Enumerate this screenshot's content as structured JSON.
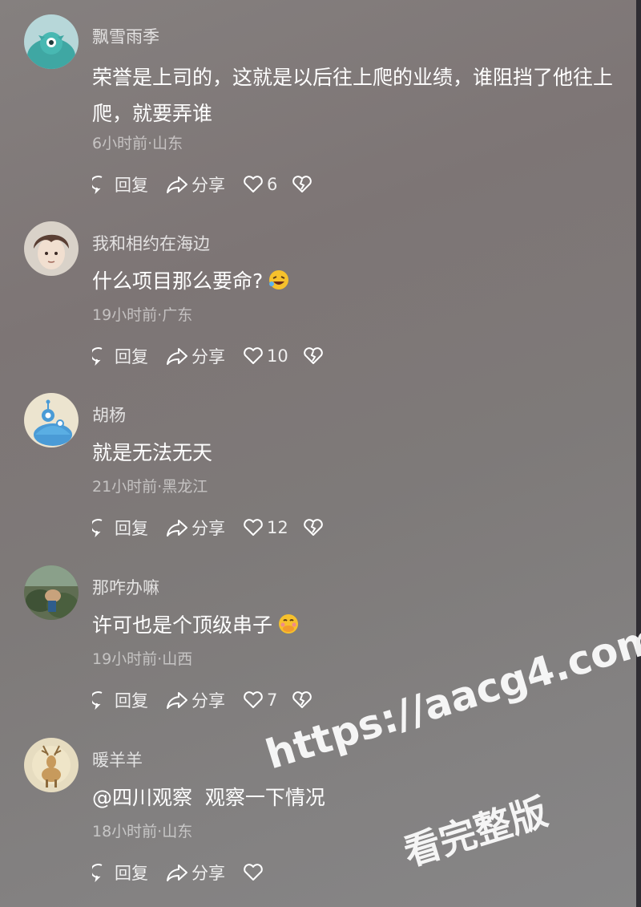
{
  "comments": [
    {
      "username": "飘雪雨季",
      "content": "荣誉是上司的，这就是以后往上爬的业绩，谁阻挡了他往上爬，就要弄谁",
      "meta": "6小时前·山东",
      "reply_label": "回复",
      "share_label": "分享",
      "likes": "6",
      "avatar_icon": "teal-monster-avatar"
    },
    {
      "username": "我和相约在海边",
      "content": "什么项目那么要命?",
      "emoji": "rolling-laugh-emoji",
      "meta": "19小时前·广东",
      "reply_label": "回复",
      "share_label": "分享",
      "likes": "10",
      "avatar_icon": "anime-boy-avatar"
    },
    {
      "username": "胡杨",
      "content": "就是无法无天",
      "meta": "21小时前·黑龙江",
      "reply_label": "回复",
      "share_label": "分享",
      "likes": "12",
      "avatar_icon": "blue-robot-avatar"
    },
    {
      "username": "那咋办嘛",
      "content": "许可也是个顶级串子",
      "emoji": "hand-over-mouth-emoji",
      "meta": "19小时前·山西",
      "reply_label": "回复",
      "share_label": "分享",
      "likes": "7",
      "avatar_icon": "outdoor-photo-avatar"
    },
    {
      "username": "暖羊羊",
      "content": "@四川观察  观察一下情况",
      "meta": "18小时前·山东",
      "reply_label": "回复",
      "share_label": "分享",
      "likes": "",
      "avatar_icon": "deer-painting-avatar"
    }
  ],
  "watermark": {
    "line1": "https://aacg4.com",
    "line2": "看完整版"
  },
  "colors": {
    "background": "#817b7a",
    "text": "#ffffff",
    "meta": "#c7c3c2"
  }
}
